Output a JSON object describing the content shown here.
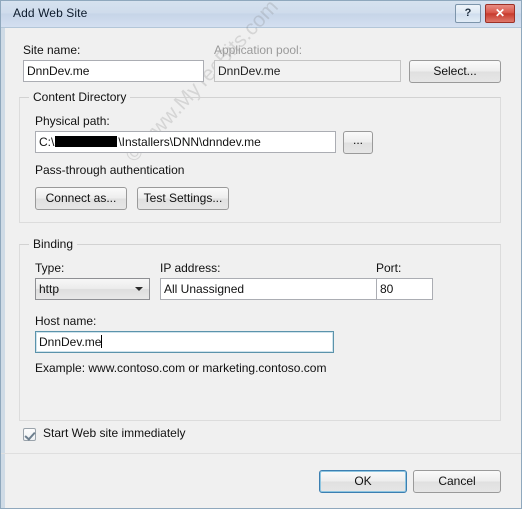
{
  "window": {
    "title": "Add Web Site",
    "help_button": "?",
    "close_button": "✕"
  },
  "form": {
    "site_name_label": "Site name:",
    "site_name_value": "DnnDev.me",
    "app_pool_label": "Application pool:",
    "app_pool_value": "DnnDev.me",
    "select_button": "Select..."
  },
  "content_directory": {
    "group_title": "Content Directory",
    "physical_path_label": "Physical path:",
    "physical_path_prefix": "C:\\",
    "physical_path_suffix": "\\Installers\\DNN\\dnndev.me",
    "browse_button": "...",
    "pass_through_label": "Pass-through authentication",
    "connect_as_button": "Connect as...",
    "test_settings_button": "Test Settings..."
  },
  "binding": {
    "group_title": "Binding",
    "type_label": "Type:",
    "type_value": "http",
    "ip_label": "IP address:",
    "ip_value": "All Unassigned",
    "port_label": "Port:",
    "port_value": "80",
    "host_label": "Host name:",
    "host_value": "DnnDev.me",
    "example_text": "Example: www.contoso.com or marketing.contoso.com"
  },
  "footer": {
    "start_checkbox_label": "Start Web site immediately",
    "ok_button": "OK",
    "cancel_button": "Cancel"
  },
  "watermark": {
    "text": "© www.MyTecBits.com"
  },
  "colors": {
    "titlebar": "#cfdcec",
    "close_button": "#c73b2e",
    "focus_border": "#5b93ab",
    "default_button_ring": "#3c7fb1"
  }
}
